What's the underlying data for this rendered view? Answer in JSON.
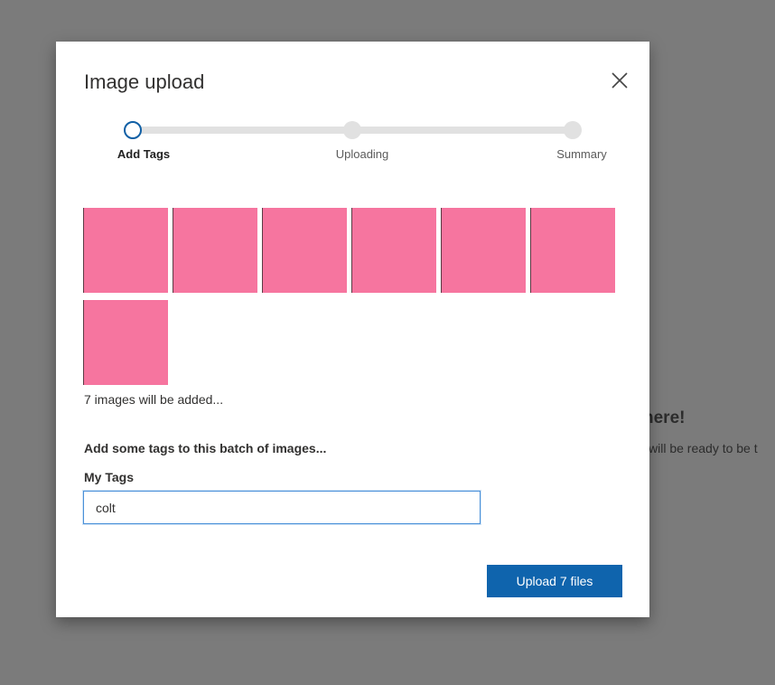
{
  "background": {
    "heading_fragment": "here!",
    "sub_fragment": "will be ready to be t"
  },
  "modal": {
    "title": "Image upload",
    "close_icon": "close-icon"
  },
  "stepper": {
    "steps": [
      {
        "label": "Add Tags",
        "state": "active"
      },
      {
        "label": "Uploading",
        "state": "inactive"
      },
      {
        "label": "Summary",
        "state": "inactive"
      }
    ]
  },
  "thumbnails": {
    "count": 7,
    "color": "#f6759f"
  },
  "images_note": "7 images will be added...",
  "tags": {
    "heading": "Add some tags to this batch of images...",
    "label": "My Tags",
    "value": "colt",
    "placeholder": ""
  },
  "upload_button": {
    "label": "Upload 7 files"
  },
  "colors": {
    "accent": "#0f64ad",
    "active_step_ring": "#0f5fa5",
    "track": "#e1e1e1",
    "backdrop": "#7b7b7b"
  }
}
